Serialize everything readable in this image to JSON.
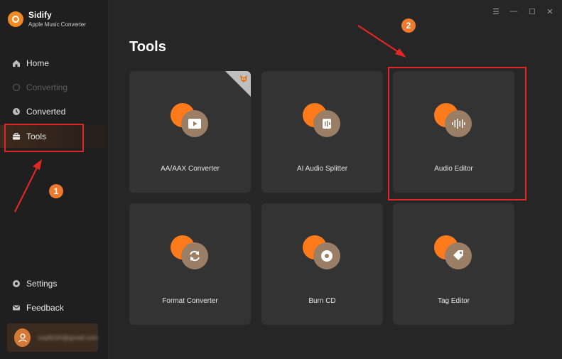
{
  "app": {
    "name": "Sidify",
    "subtitle": "Apple Music Converter"
  },
  "sidebar": {
    "items": [
      {
        "label": "Home",
        "icon": "home-icon",
        "state": "normal"
      },
      {
        "label": "Converting",
        "icon": "converting-icon",
        "state": "disabled"
      },
      {
        "label": "Converted",
        "icon": "clock-icon",
        "state": "normal"
      },
      {
        "label": "Tools",
        "icon": "toolbox-icon",
        "state": "active"
      }
    ],
    "bottom": [
      {
        "label": "Settings",
        "icon": "gear-icon"
      },
      {
        "label": "Feedback",
        "icon": "mail-icon"
      }
    ],
    "user": {
      "email": "cep8230@gmail.com"
    }
  },
  "window": {
    "menu": "☰",
    "minimize": "—",
    "maximize": "☐",
    "close": "✕"
  },
  "main": {
    "title": "Tools",
    "tools": [
      {
        "label": "AA/AAX Converter",
        "icon": "video-play-icon",
        "badge": true
      },
      {
        "label": "AI Audio Splitter",
        "icon": "ai-splitter-icon"
      },
      {
        "label": "Audio Editor",
        "icon": "waveform-icon"
      },
      {
        "label": "Format Converter",
        "icon": "refresh-icon"
      },
      {
        "label": "Burn CD",
        "icon": "cd-icon"
      },
      {
        "label": "Tag Editor",
        "icon": "tag-icon"
      }
    ]
  },
  "annotations": {
    "step1": "1",
    "step2": "2"
  },
  "colors": {
    "accent": "#ff7a1a",
    "highlight": "#e02626",
    "background": "#262626",
    "sidebar": "#1f1f1f",
    "card": "#333333"
  }
}
